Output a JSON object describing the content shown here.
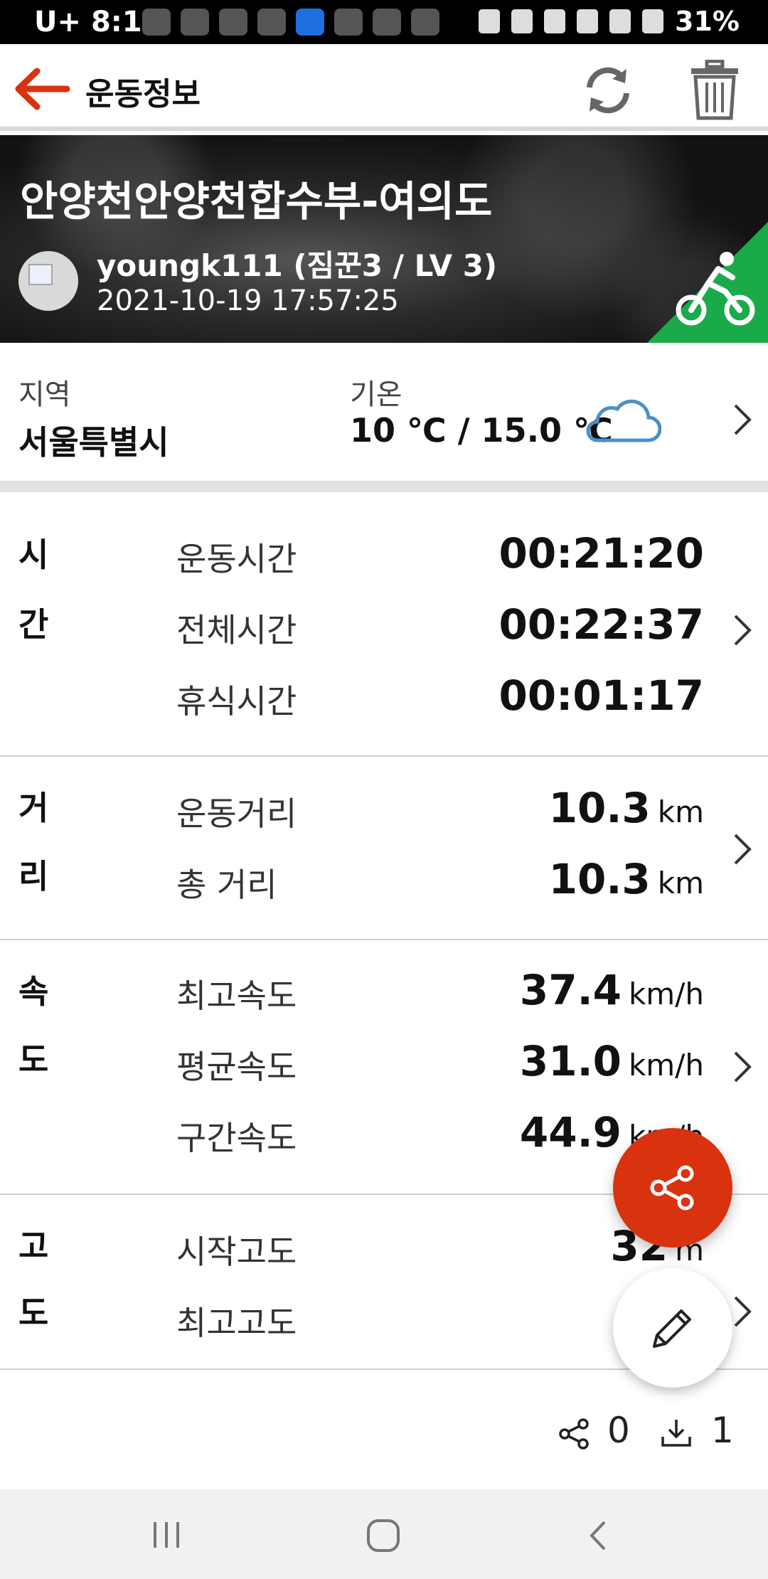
{
  "status_bar": {
    "time": "8:14",
    "carrier": "U+",
    "battery": "31%"
  },
  "app_bar": {
    "title": "운동정보"
  },
  "route": {
    "title": "안양천안양천합수부-여의도",
    "user": "youngk111 (짐꾼3 / LV 3)",
    "datetime": "2021-10-19 17:57:25",
    "activity_color": "#1aaa4a"
  },
  "region": {
    "label": "지역",
    "value": "서울특별시",
    "temp_label": "기온",
    "temp_value": "10 ℃ / 15.0 ℃"
  },
  "time_section": {
    "heading_1": "시",
    "heading_2": "간",
    "rows": [
      {
        "label": "운동시간",
        "value": "00:21:20"
      },
      {
        "label": "전체시간",
        "value": "00:22:37"
      },
      {
        "label": "휴식시간",
        "value": "00:01:17"
      }
    ]
  },
  "distance_section": {
    "heading_1": "거",
    "heading_2": "리",
    "rows": [
      {
        "label": "운동거리",
        "value": "10.3",
        "unit": "km"
      },
      {
        "label": "총 거리",
        "value": "10.3",
        "unit": "km"
      }
    ]
  },
  "speed_section": {
    "heading_1": "속",
    "heading_2": "도",
    "rows": [
      {
        "label": "최고속도",
        "value": "37.4",
        "unit": "km/h"
      },
      {
        "label": "평균속도",
        "value": "31.0",
        "unit": "km/h"
      },
      {
        "label": "구간속도",
        "value": "44.9",
        "unit": "km/h"
      }
    ]
  },
  "altitude_section": {
    "heading_1": "고",
    "heading_2": "도",
    "rows": [
      {
        "label": "시작고도",
        "value": "32",
        "unit": "m"
      },
      {
        "label": "최고고도",
        "value": "",
        "unit": ""
      }
    ]
  },
  "counts": {
    "shares": "0",
    "downloads": "1"
  },
  "colors": {
    "accent": "#d9320e",
    "activity": "#1aaa4a",
    "cloud": "#4a90c8"
  },
  "icons": [
    "back-arrow-icon",
    "sync-icon",
    "trash-icon",
    "bicycle-icon",
    "cloud-icon",
    "chevron-right-icon",
    "share-icon",
    "pencil-icon",
    "download-icon"
  ]
}
